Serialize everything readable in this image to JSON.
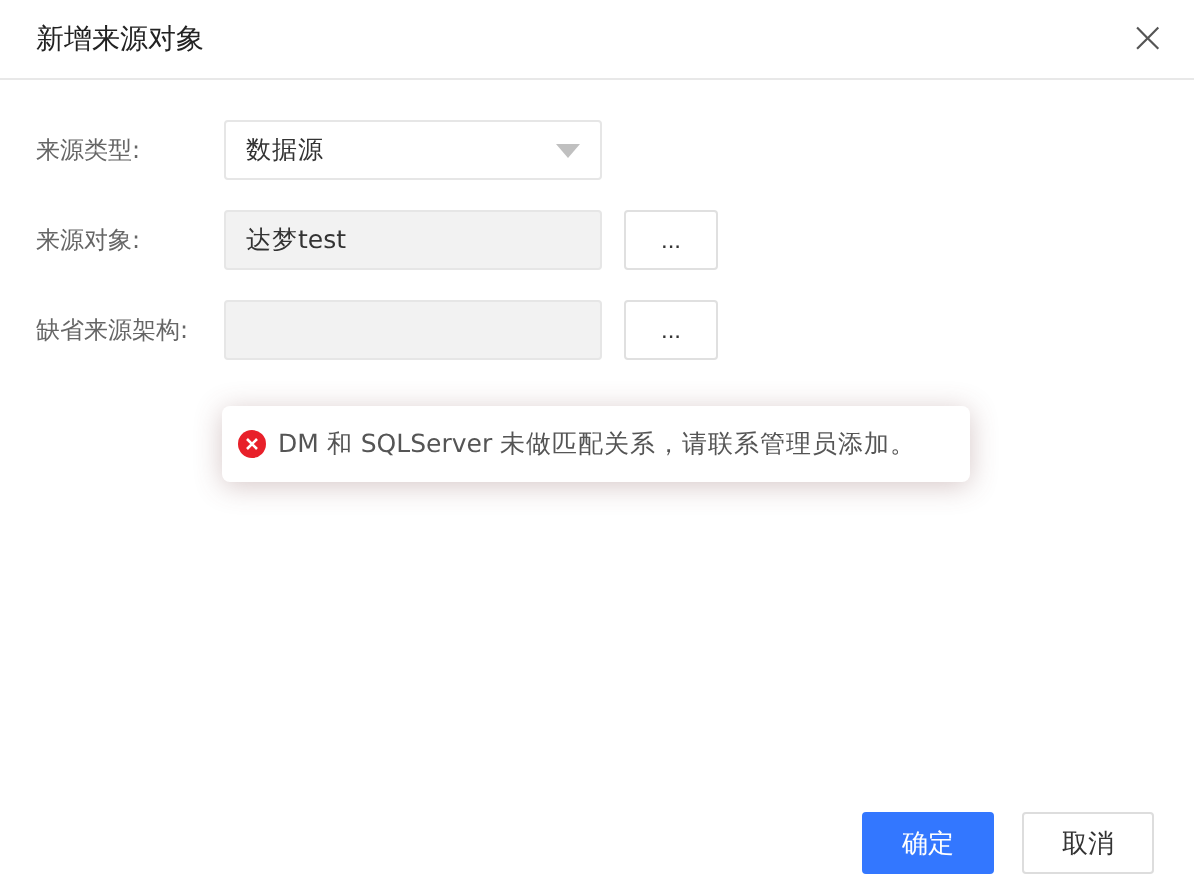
{
  "dialog": {
    "title": "新增来源对象",
    "close_icon": "×"
  },
  "fields": [
    {
      "label": "来源类型:",
      "kind": "select",
      "value": "数据源",
      "disabled": false
    },
    {
      "label": "来源对象:",
      "kind": "picker",
      "value": "达梦test",
      "disabled": true,
      "button": "..."
    },
    {
      "label": "缺省来源架构:",
      "kind": "picker",
      "disabled": true,
      "button": "..."
    }
  ],
  "toast": {
    "kind": "error",
    "message": "DM 和 SQLServer 未做匹配关系，请联系管理员添加。"
  },
  "buttons": [
    {
      "label": "确定",
      "kind": "primary"
    },
    {
      "label": "取消",
      "kind": "default"
    }
  ]
}
